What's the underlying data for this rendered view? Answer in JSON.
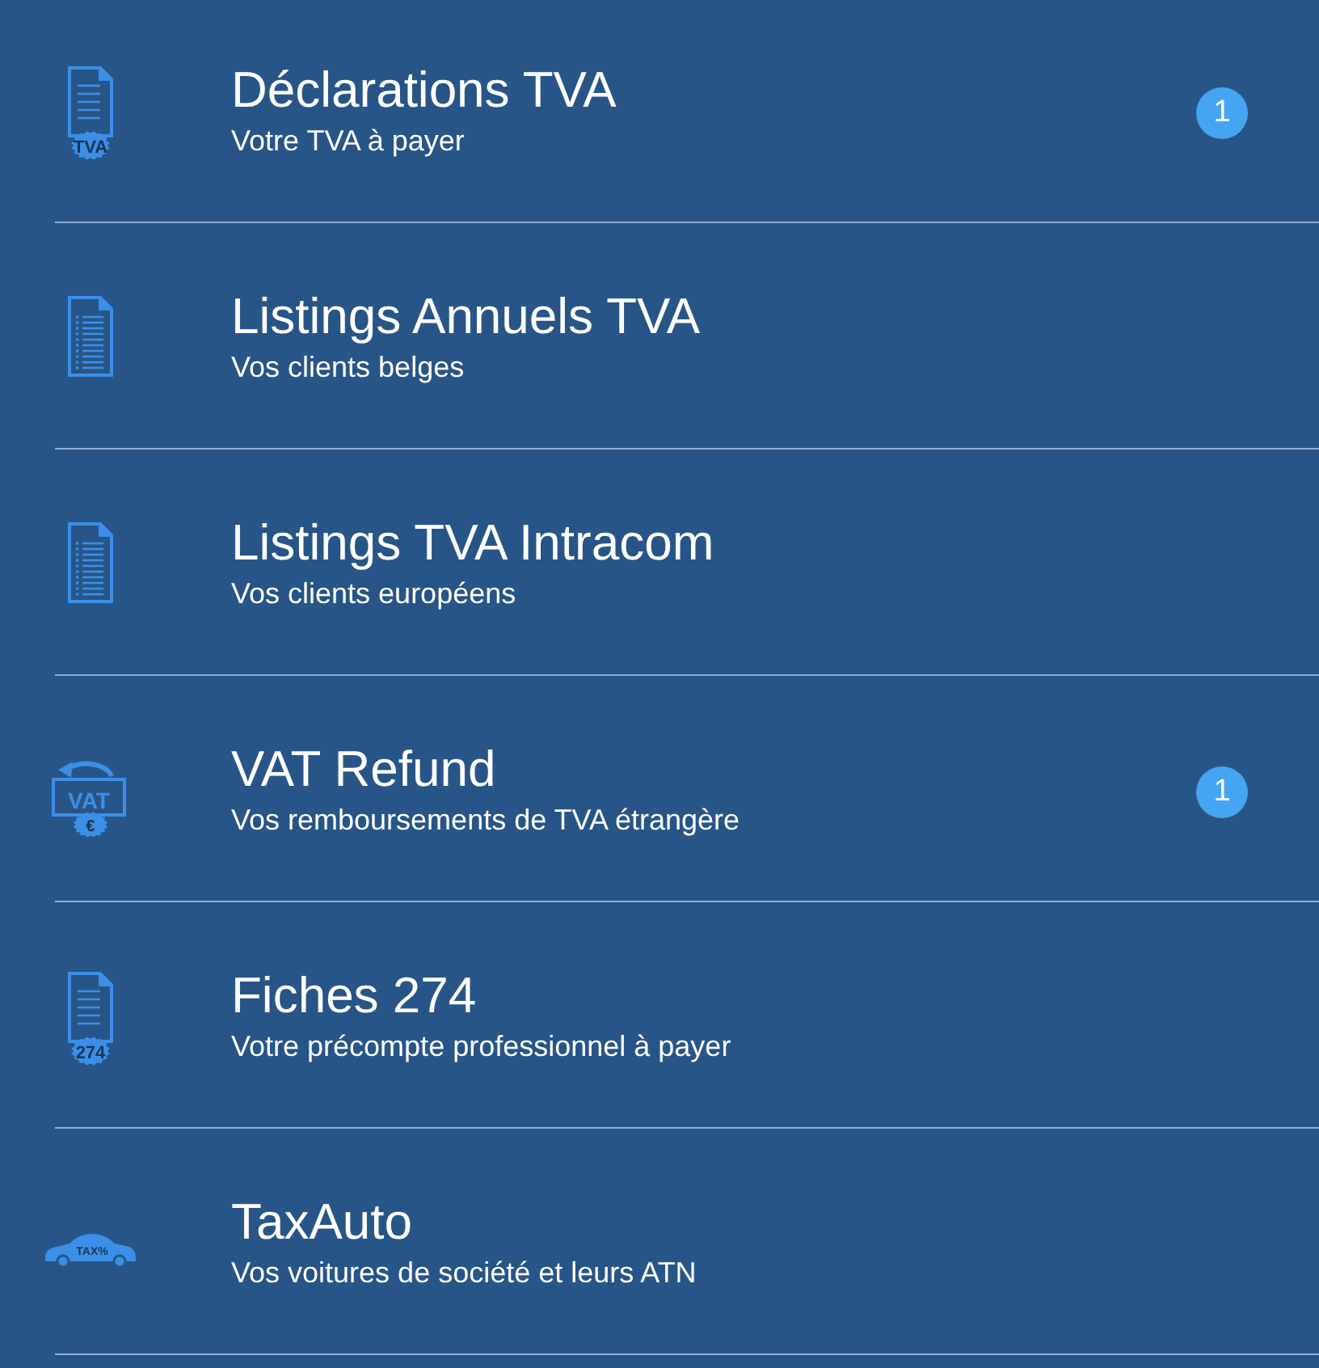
{
  "items": [
    {
      "icon": {
        "kind": "doc-badge",
        "text": "TVA"
      },
      "title": "Déclarations TVA",
      "subtitle": "Votre TVA à payer",
      "badge": "1"
    },
    {
      "icon": {
        "kind": "list-doc"
      },
      "title": "Listings Annuels TVA",
      "subtitle": "Vos clients belges"
    },
    {
      "icon": {
        "kind": "list-doc"
      },
      "title": "Listings TVA Intracom",
      "subtitle": "Vos clients européens"
    },
    {
      "icon": {
        "kind": "vat",
        "text": "VAT",
        "subtext": "€"
      },
      "title": "VAT Refund",
      "subtitle": "Vos remboursements de TVA étrangère",
      "badge": "1"
    },
    {
      "icon": {
        "kind": "doc-badge",
        "text": "274"
      },
      "title": "Fiches 274",
      "subtitle": "Votre précompte professionnel à payer"
    },
    {
      "icon": {
        "kind": "car",
        "text": "TAX%"
      },
      "title": "TaxAuto",
      "subtitle": "Vos voitures de société et leurs ATN"
    }
  ]
}
